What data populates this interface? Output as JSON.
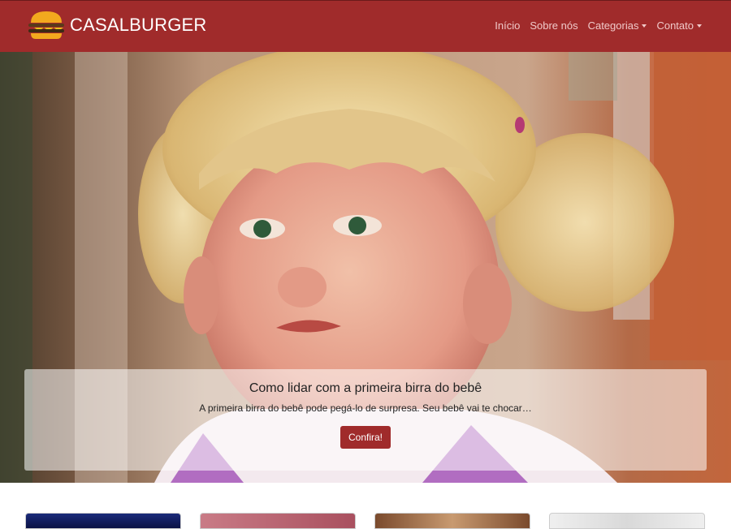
{
  "brand": {
    "name": "CASALBURGER",
    "logo_icon": "burger-icon"
  },
  "nav": {
    "items": [
      {
        "label": "Início"
      },
      {
        "label": "Sobre nós"
      },
      {
        "label": "Categorias",
        "dropdown": true
      },
      {
        "label": "Contato",
        "dropdown": true
      }
    ]
  },
  "hero": {
    "image": "crying-toddler-photo",
    "title": "Como lidar com a primeira birra do bebê",
    "text": "A primeira birra do bebê pode pegá-lo de surpresa. Seu bebê vai te chocar…",
    "button_label": "Confira!"
  },
  "cards": {
    "thumbnails": [
      "fireworks-thumbnail",
      "silhouette-thumbnail",
      "child-thumbnail",
      "woman-thumbnail"
    ]
  },
  "colors": {
    "primary": "#a02b2b",
    "nav_text": "#f0c9c9"
  }
}
